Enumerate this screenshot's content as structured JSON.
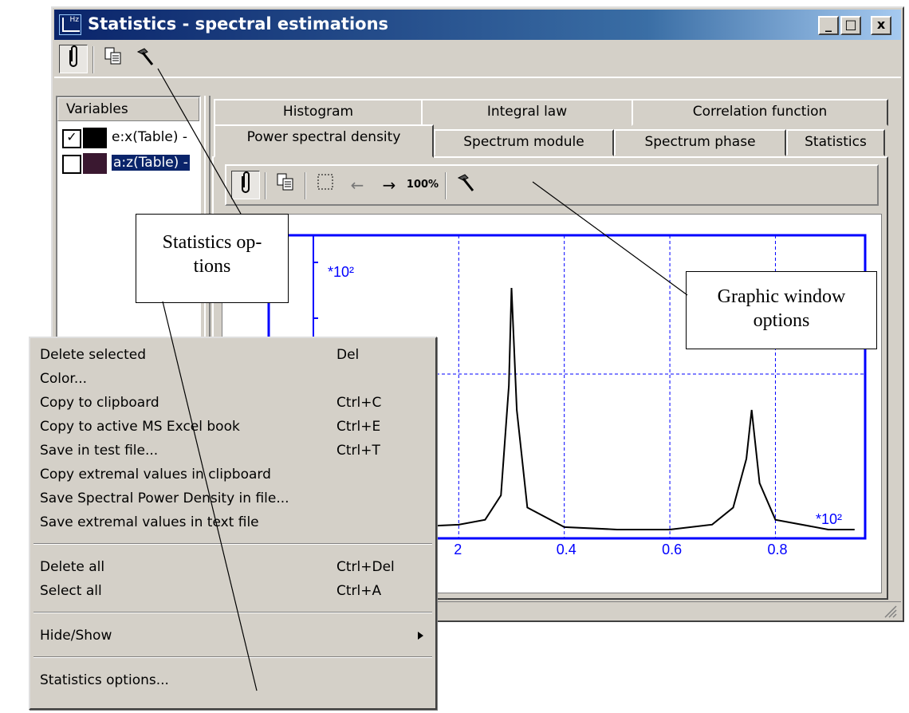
{
  "window": {
    "title": "Statistics - spectral estimations",
    "icon_text": "Hz",
    "caption_buttons": {
      "minimize": "_",
      "maximize": "□",
      "close": "x"
    }
  },
  "toolbar": {
    "icons": [
      "clip-icon",
      "copy-icon",
      "hammer-icon"
    ]
  },
  "variables": {
    "header": "Variables",
    "items": [
      {
        "label": "e:x(Table) -",
        "checked": true,
        "swatch": "#000000",
        "selected": false
      },
      {
        "label": "a:z(Table) -",
        "checked": false,
        "swatch": "#3a1830",
        "selected": true
      }
    ]
  },
  "tabs": {
    "row1": [
      "Histogram",
      "Integral law",
      "Correlation function"
    ],
    "row2": [
      "Power spectral density",
      "Spectrum module",
      "Spectrum phase",
      "Statistics"
    ],
    "active": "Power spectral density"
  },
  "graph_toolbar": {
    "zoom_label": "100%",
    "icons": [
      "clip-icon",
      "copy-icon",
      "selection-rect-icon",
      "arrow-left-icon",
      "arrow-right-icon",
      "zoom-100-icon",
      "hammer-icon"
    ]
  },
  "chart_data": {
    "type": "line",
    "y_multiplier": "*10²",
    "x_multiplier": "*10²",
    "x_tick_labels": [
      "2",
      "0.4",
      "0.6",
      "0.8"
    ],
    "x": [
      0.0,
      0.1,
      0.2,
      0.25,
      0.28,
      0.295,
      0.3,
      0.31,
      0.33,
      0.4,
      0.5,
      0.6,
      0.68,
      0.72,
      0.745,
      0.755,
      0.77,
      0.8,
      0.9,
      0.95
    ],
    "series": [
      {
        "values": [
          0.02,
          0.02,
          0.03,
          0.05,
          0.15,
          0.6,
          1.0,
          0.5,
          0.1,
          0.02,
          0.01,
          0.01,
          0.03,
          0.1,
          0.3,
          0.5,
          0.2,
          0.05,
          0.01,
          0.01
        ]
      }
    ],
    "grid": true
  },
  "context_menu": {
    "group1": [
      {
        "label": "Delete selected",
        "shortcut": "Del"
      },
      {
        "label": "Color...",
        "shortcut": ""
      },
      {
        "label": "Copy to clipboard",
        "shortcut": "Ctrl+C"
      },
      {
        "label": "Copy to active MS Excel book",
        "shortcut": "Ctrl+E"
      },
      {
        "label": "Save in test file...",
        "shortcut": "Ctrl+T"
      },
      {
        "label": "Copy extremal values in clipboard",
        "shortcut": ""
      },
      {
        "label": "Save Spectral Power Density in file...",
        "shortcut": ""
      },
      {
        "label": "Save extremal values in text file",
        "shortcut": ""
      }
    ],
    "group2": [
      {
        "label": "Delete all",
        "shortcut": "Ctrl+Del"
      },
      {
        "label": "Select all",
        "shortcut": "Ctrl+A"
      }
    ],
    "group3": [
      {
        "label": "Hide/Show",
        "shortcut": ""
      }
    ],
    "group4": [
      {
        "label": "Statistics options...",
        "shortcut": ""
      }
    ]
  },
  "callouts": {
    "statistics_options": {
      "line1": "Statistics op-",
      "line2": "tions"
    },
    "graphic_window_options": {
      "line1": "Graphic window",
      "line2": "options"
    }
  }
}
